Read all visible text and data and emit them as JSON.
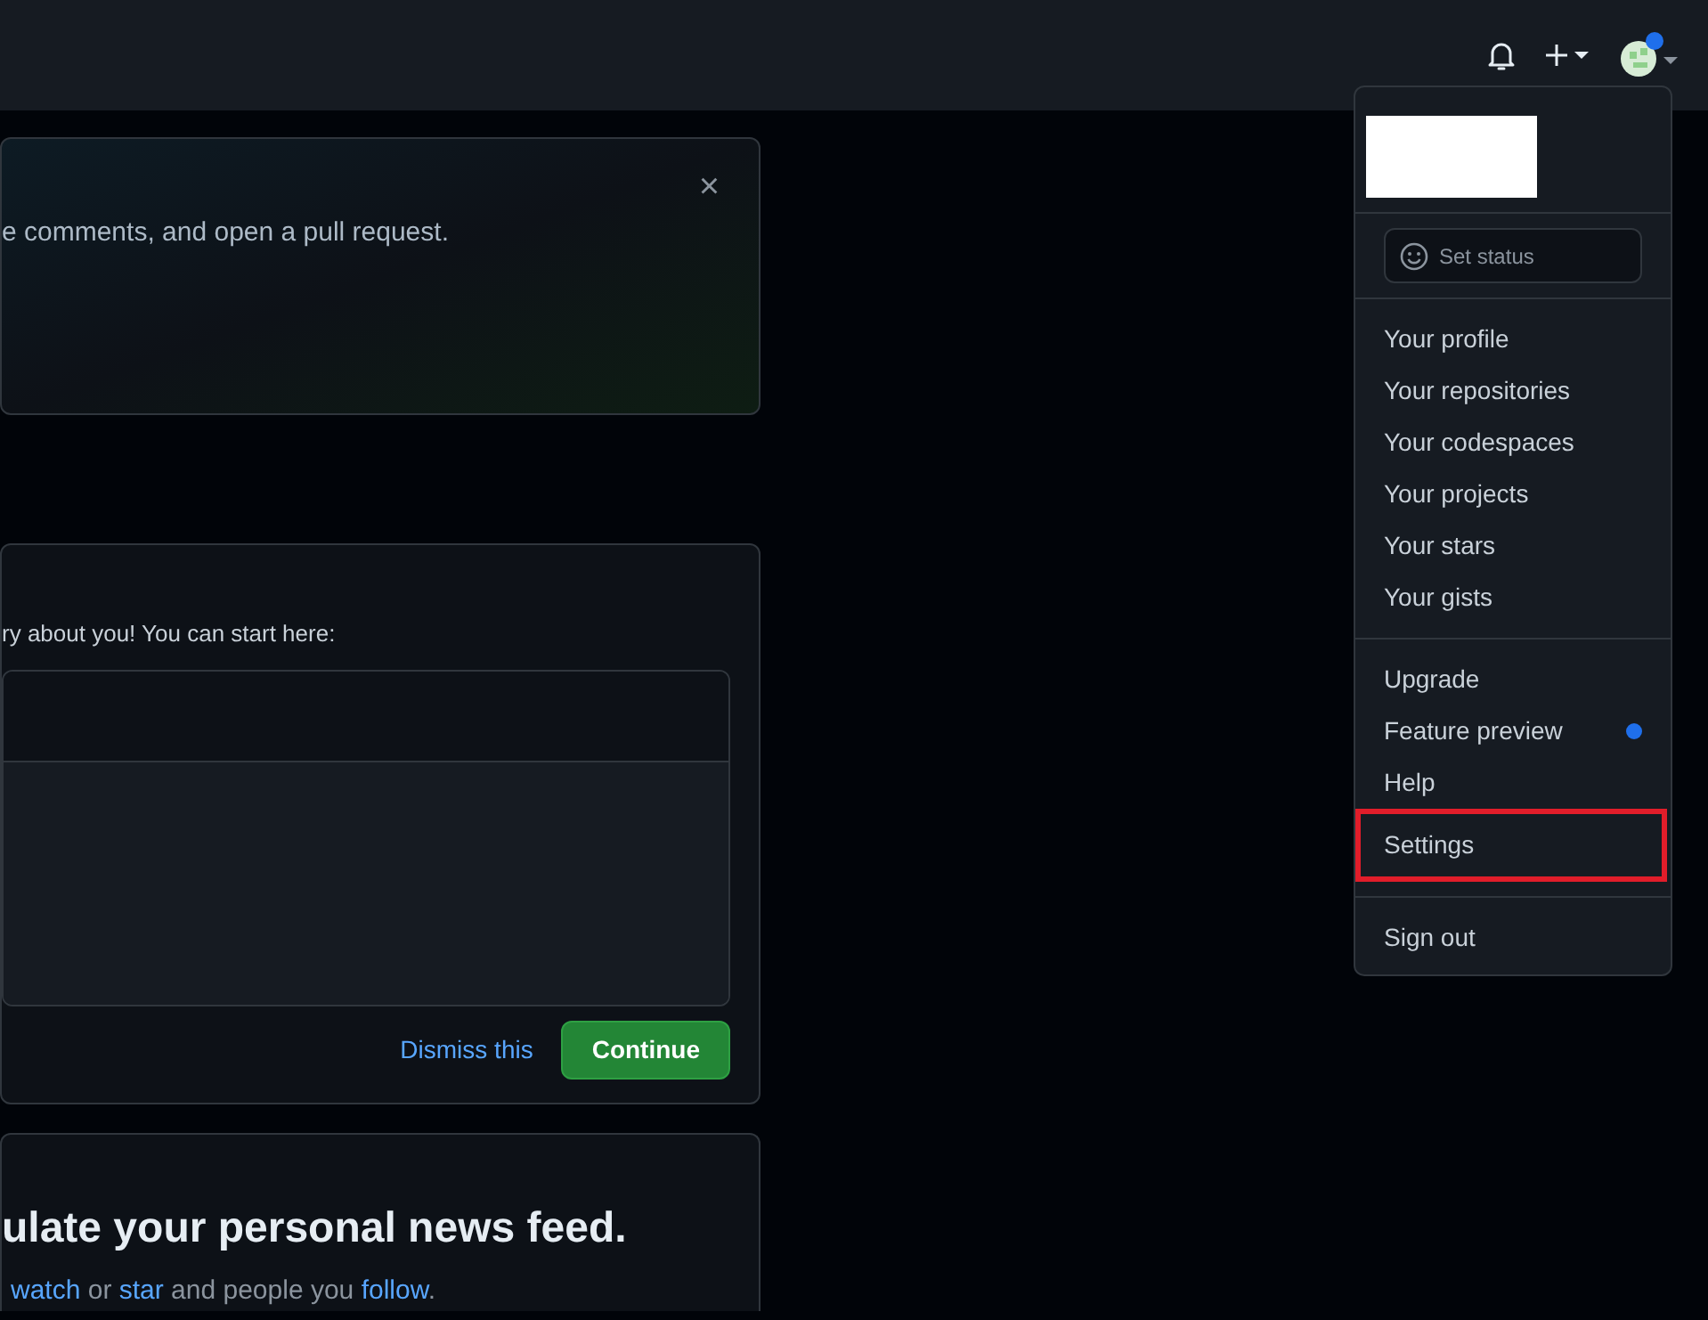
{
  "header": {
    "notifications": {
      "unread": false
    },
    "create_menu": {
      "expanded": false
    },
    "avatar": {
      "has_status_dot": true,
      "expanded": true
    }
  },
  "banner": {
    "text": "e comments, and open a pull request.",
    "close": "×"
  },
  "readme_card": {
    "text": "ry about you! You can start here:",
    "dismiss": "Dismiss this",
    "continue": "Continue"
  },
  "feed_card": {
    "heading": "ulate your personal news feed.",
    "segments": [
      {
        "text": "watch",
        "link": true
      },
      {
        "text": " or ",
        "link": false
      },
      {
        "text": "star",
        "link": true
      },
      {
        "text": " and people you ",
        "link": false
      },
      {
        "text": "follow",
        "link": true
      },
      {
        "text": ".",
        "link": false
      }
    ]
  },
  "user_menu": {
    "set_status": "Set status",
    "groups": [
      [
        {
          "label": "Your profile",
          "highlighted": false,
          "new_dot": false
        },
        {
          "label": "Your repositories",
          "highlighted": false,
          "new_dot": false
        },
        {
          "label": "Your codespaces",
          "highlighted": false,
          "new_dot": false
        },
        {
          "label": "Your projects",
          "highlighted": false,
          "new_dot": false
        },
        {
          "label": "Your stars",
          "highlighted": false,
          "new_dot": false
        },
        {
          "label": "Your gists",
          "highlighted": false,
          "new_dot": false
        }
      ],
      [
        {
          "label": "Upgrade",
          "highlighted": false,
          "new_dot": false
        },
        {
          "label": "Feature preview",
          "highlighted": false,
          "new_dot": true
        },
        {
          "label": "Help",
          "highlighted": false,
          "new_dot": false
        },
        {
          "label": "Settings",
          "highlighted": true,
          "new_dot": false
        }
      ],
      [
        {
          "label": "Sign out",
          "highlighted": false,
          "new_dot": false
        }
      ]
    ]
  }
}
